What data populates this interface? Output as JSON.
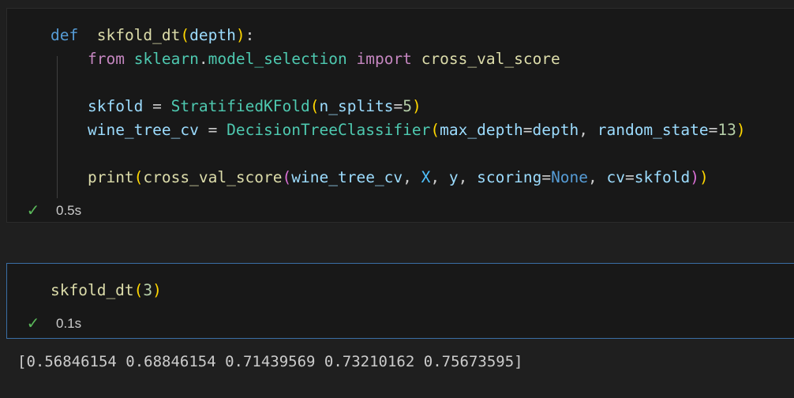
{
  "cells": [
    {
      "lines": [
        [
          [
            "kw",
            "def"
          ],
          [
            "",
            "  "
          ],
          [
            "fn",
            "skfold_dt"
          ],
          [
            "p1",
            "("
          ],
          [
            "var",
            "depth"
          ],
          [
            "p1",
            ")"
          ],
          [
            "",
            ":"
          ]
        ],
        [
          [
            "",
            "    "
          ],
          [
            "kw2",
            "from"
          ],
          [
            "",
            " "
          ],
          [
            "cls",
            "sklearn"
          ],
          [
            "",
            "."
          ],
          [
            "cls",
            "model_selection"
          ],
          [
            "",
            " "
          ],
          [
            "kw2",
            "import"
          ],
          [
            "",
            " "
          ],
          [
            "fn",
            "cross_val_score"
          ]
        ],
        [],
        [
          [
            "",
            "    "
          ],
          [
            "var",
            "skfold"
          ],
          [
            "",
            " = "
          ],
          [
            "cls",
            "StratifiedKFold"
          ],
          [
            "p1",
            "("
          ],
          [
            "var",
            "n_splits"
          ],
          [
            "",
            "="
          ],
          [
            "num",
            "5"
          ],
          [
            "p1",
            ")"
          ]
        ],
        [
          [
            "",
            "    "
          ],
          [
            "var",
            "wine_tree_cv"
          ],
          [
            "",
            " = "
          ],
          [
            "cls",
            "DecisionTreeClassifier"
          ],
          [
            "p1",
            "("
          ],
          [
            "var",
            "max_depth"
          ],
          [
            "",
            "="
          ],
          [
            "var",
            "depth"
          ],
          [
            "",
            ", "
          ],
          [
            "var",
            "random_state"
          ],
          [
            "",
            "="
          ],
          [
            "num",
            "13"
          ],
          [
            "p1",
            ")"
          ]
        ],
        [],
        [
          [
            "",
            "    "
          ],
          [
            "fn",
            "print"
          ],
          [
            "p1",
            "("
          ],
          [
            "fn",
            "cross_val_score"
          ],
          [
            "p2",
            "("
          ],
          [
            "var",
            "wine_tree_cv"
          ],
          [
            "",
            ", "
          ],
          [
            "const",
            "X"
          ],
          [
            "",
            ", "
          ],
          [
            "var",
            "y"
          ],
          [
            "",
            ", "
          ],
          [
            "var",
            "scoring"
          ],
          [
            "",
            "="
          ],
          [
            "kw",
            "None"
          ],
          [
            "",
            ", "
          ],
          [
            "var",
            "cv"
          ],
          [
            "",
            "="
          ],
          [
            "var",
            "skfold"
          ],
          [
            "p2",
            ")"
          ],
          [
            "p1",
            ")"
          ]
        ]
      ],
      "status": {
        "icon": "check-icon",
        "time": "0.5s"
      }
    },
    {
      "lines": [
        [
          [
            "fn",
            "skfold_dt"
          ],
          [
            "p1",
            "("
          ],
          [
            "num",
            "3"
          ],
          [
            "p1",
            ")"
          ]
        ]
      ],
      "status": {
        "icon": "check-icon",
        "time": "0.1s"
      },
      "output": "[0.56846154 0.68846154 0.71439569 0.73210162 0.75673595]"
    }
  ],
  "colors": {
    "keyword": "#569cd6",
    "import_keyword": "#c586c0",
    "function": "#dcdcaa",
    "class": "#4ec9b0",
    "variable": "#9cdcfe",
    "number": "#b5cea8",
    "success": "#5ab85a",
    "active_border": "#3a6ea5"
  }
}
